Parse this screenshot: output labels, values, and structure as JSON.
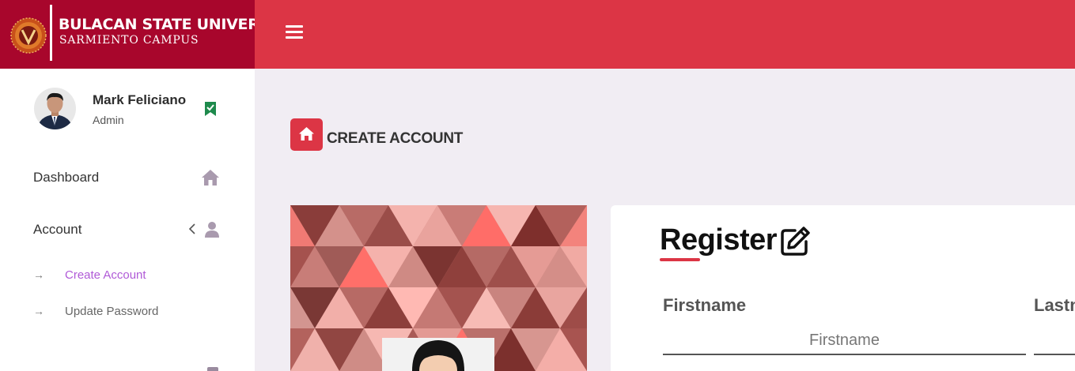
{
  "brand": {
    "title": "BULACAN STATE UNIVERSITY",
    "subtitle": "SARMIENTO CAMPUS",
    "color": "#a8062c"
  },
  "topbar": {
    "color": "#dc3545",
    "menu_icon": "hamburger-menu-icon"
  },
  "user": {
    "name": "Mark Feliciano",
    "role": "Admin",
    "status_icon": "verified-badge-icon"
  },
  "sidebar": {
    "items": [
      {
        "label": "Dashboard",
        "icon": "home-icon"
      },
      {
        "label": "Account",
        "icon": "user-icon",
        "expand_icon": "chevron-left-icon"
      }
    ],
    "sub_items": [
      {
        "label": "Create Account",
        "active": true,
        "icon": "arrow-right-icon"
      },
      {
        "label": "Update Password",
        "active": false,
        "icon": "arrow-right-icon"
      }
    ]
  },
  "page": {
    "title": "CREATE ACCOUNT",
    "icon": "home-icon"
  },
  "form": {
    "title": "Register",
    "title_icon": "edit-icon",
    "firstname_label": "Firstname",
    "firstname_placeholder": "Firstname",
    "lastname_label": "Lastn"
  },
  "colors": {
    "accent": "#dc3545",
    "active_link": "#b05ad7",
    "background": "#f1edf3"
  }
}
